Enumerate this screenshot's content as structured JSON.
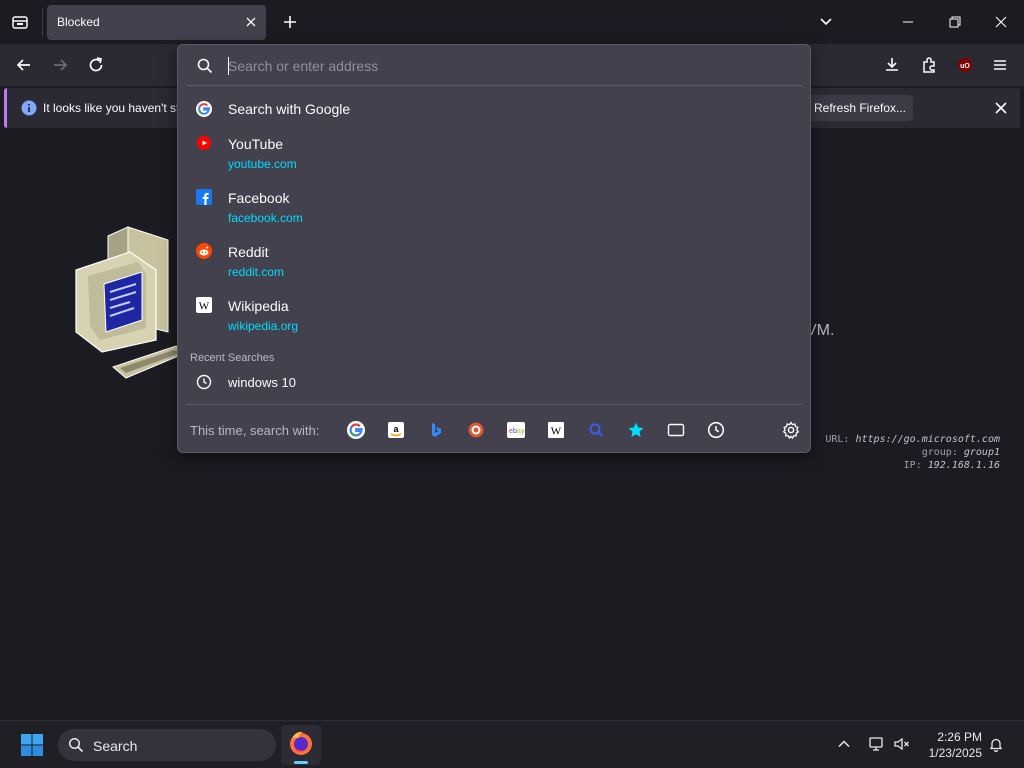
{
  "tab": {
    "title": "Blocked"
  },
  "notification": {
    "text": "It looks like you haven't st",
    "button": "Refresh Firefox..."
  },
  "page": {
    "fragment": "VM.",
    "meta": {
      "url_label": "URL:",
      "url_value": "https://go.microsoft.com",
      "group_label": "group:",
      "group_value": "group1",
      "ip_label": "IP:",
      "ip_value": "192.168.1.16"
    }
  },
  "urlbar": {
    "placeholder": "Search or enter address",
    "search_with_google": "Search with Google",
    "shortcuts": [
      {
        "title": "YouTube",
        "url": "youtube.com",
        "icon": "youtube-icon"
      },
      {
        "title": "Facebook",
        "url": "facebook.com",
        "icon": "facebook-icon"
      },
      {
        "title": "Reddit",
        "url": "reddit.com",
        "icon": "reddit-icon"
      },
      {
        "title": "Wikipedia",
        "url": "wikipedia.org",
        "icon": "wikipedia-icon"
      }
    ],
    "recent_label": "Recent Searches",
    "recent": [
      "windows 10"
    ],
    "search_with_label": "This time, search with:",
    "engines": [
      "google-icon",
      "amazon-icon",
      "bing-icon",
      "duckduckgo-icon",
      "ebay-icon",
      "wikipedia-icon",
      "search-engine-icon",
      "bookmarks-icon",
      "tabs-icon",
      "history-icon"
    ]
  },
  "taskbar": {
    "search": "Search",
    "time": "2:26 PM",
    "date": "1/23/2025"
  },
  "colors": {
    "accent_link": "#00ddff",
    "panel": "#42414d",
    "toolbar": "#2b2a33",
    "notice_accent": "#b97cf2"
  }
}
